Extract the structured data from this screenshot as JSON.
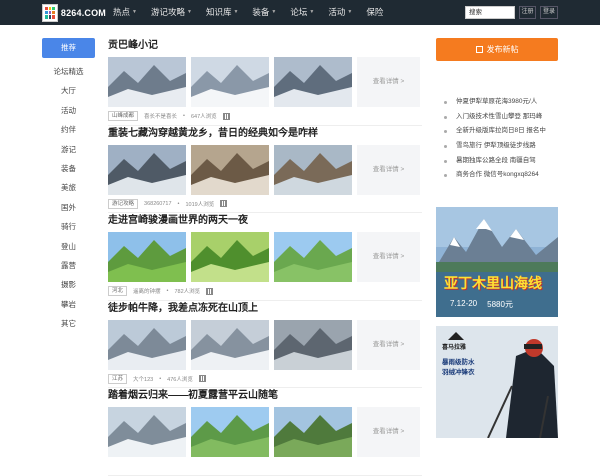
{
  "header": {
    "logo_text": "8264.COM",
    "nav": [
      {
        "label": "热点",
        "caret": true
      },
      {
        "label": "游记攻略",
        "caret": true
      },
      {
        "label": "知识库",
        "caret": true
      },
      {
        "label": "装备",
        "caret": true
      },
      {
        "label": "论坛",
        "caret": true
      },
      {
        "label": "活动",
        "caret": true
      },
      {
        "label": "保险",
        "caret": false
      }
    ],
    "search_placeholder": "搜索",
    "register_label": "注册",
    "login_label": "登录",
    "bg_color": "#1f2a33"
  },
  "sidebar": {
    "items": [
      "推荐",
      "论坛精选",
      "大厅",
      "活动",
      "约伴",
      "游记",
      "装备",
      "美旅",
      "国外",
      "骑行",
      "登山",
      "露营",
      "摄影",
      "攀岩",
      "其它"
    ],
    "active_index": 0,
    "accent": "#4a86e8"
  },
  "feed": {
    "more_label": "查看详情 >",
    "posts": [
      {
        "title": "贡巴峰小记",
        "tag": "山峰成都",
        "author": "喜长不是喜长",
        "views": "647人浏览"
      },
      {
        "title": "重装七藏沟穿越黄龙乡，昔日的经典如今是咋样",
        "tag": "游记攻略",
        "author": "368260717",
        "views": "1019人浏览"
      },
      {
        "title": "走进宫崎骏漫画世界的两天一夜",
        "tag": "河北",
        "author": "遥离的钟摆",
        "views": "782人浏览"
      },
      {
        "title": "徒步帕牛降，我差点冻死在山顶上",
        "tag": "江苏",
        "author": "大个123",
        "views": "476人浏览"
      },
      {
        "title": "踏着烟云归来——初夏露营平云山随笔",
        "tag": "",
        "author": "",
        "views": ""
      }
    ]
  },
  "right": {
    "publish_label": "发布新帖",
    "publish_color": "#f57b1f",
    "links": [
      "仲夏伊犁草原花海3980元/人",
      "入门级技术性雪山攀登 那玛峰",
      "全新升级版库拉岗日8日 报名中",
      "雪鸟旅行 伊犁顶级徒步线路",
      "暑期独库公路全段 南疆自驾",
      "商务合作 微信号kongxq8264"
    ],
    "banner1": {
      "title": "亚丁木里山海线",
      "date": "7.12-20",
      "price": "5880元"
    },
    "banner2": {
      "brand": "喜马拉雅",
      "line1": "暴雨级防水",
      "line2": "羽绒冲锋衣"
    }
  }
}
